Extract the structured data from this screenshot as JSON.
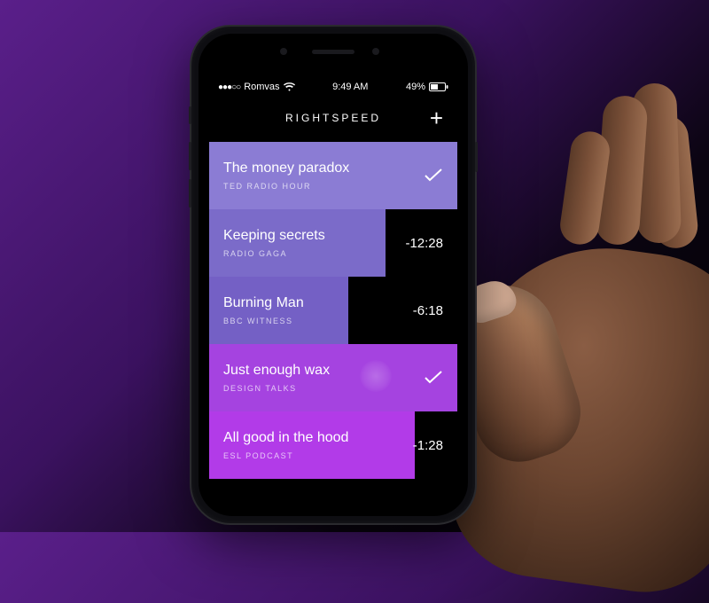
{
  "status": {
    "signal_dots": "●●●○○",
    "carrier": "Romvas",
    "time": "9:49 AM",
    "battery_pct": "49%"
  },
  "header": {
    "title": "RIGHTSPEED",
    "add_label": "+"
  },
  "colors": {
    "bg1": "#8b7cd4",
    "bg2": "#7b6bc9",
    "bg3": "#7460c5",
    "bg4": "#a543e0",
    "bg5": "#b23be8"
  },
  "items": [
    {
      "title": "The money paradox",
      "subtitle": "TED RADIO HOUR",
      "right": "check",
      "progress": 100,
      "bg": "#8b7cd4"
    },
    {
      "title": "Keeping secrets",
      "subtitle": "RADIO GAGA",
      "right": "-12:28",
      "progress": 71,
      "bg": "#7b6bc9"
    },
    {
      "title": "Burning Man",
      "subtitle": "BBC WITNESS",
      "right": "-6:18",
      "progress": 56,
      "bg": "#7460c5"
    },
    {
      "title": "Just enough wax",
      "subtitle": "DESIGN TALKS",
      "right": "check",
      "progress": 100,
      "bg": "#a543e0",
      "fingerprint": true
    },
    {
      "title": "All good in the hood",
      "subtitle": "ESL PODCAST",
      "right": "-1:28",
      "progress": 83,
      "bg": "#b23be8"
    }
  ]
}
